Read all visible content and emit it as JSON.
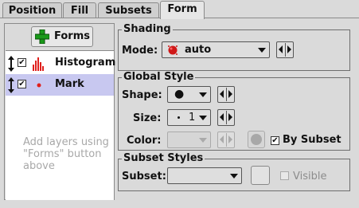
{
  "tabs": [
    {
      "label": "Position",
      "active": false
    },
    {
      "label": "Fill",
      "active": false
    },
    {
      "label": "Subsets",
      "active": false
    },
    {
      "label": "Form",
      "active": true
    }
  ],
  "left": {
    "forms_button": "Forms",
    "layers": [
      {
        "label": "Histogram",
        "checked": true,
        "selected": false,
        "icon": "histogram-icon"
      },
      {
        "label": "Mark",
        "checked": true,
        "selected": true,
        "icon": "mark-icon"
      }
    ],
    "hint": "Add layers using \"Forms\" button above"
  },
  "shading": {
    "title": "Shading",
    "mode_label": "Mode:",
    "mode_value": "auto",
    "mode_icon": "auto-shading-icon"
  },
  "global_style": {
    "title": "Global Style",
    "shape_label": "Shape:",
    "shape_value": "●",
    "size_label": "Size:",
    "size_value": "1",
    "color_label": "Color:",
    "by_subset_label": "By Subset",
    "by_subset_checked": true
  },
  "subset_styles": {
    "title": "Subset Styles",
    "subset_label": "Subset:",
    "subset_value": "",
    "visible_label": "Visible",
    "visible_checked": false
  },
  "colors": {
    "accent_red": "#e0201c",
    "plus_green": "#1a9a1a",
    "selection": "#c8c8f0"
  }
}
